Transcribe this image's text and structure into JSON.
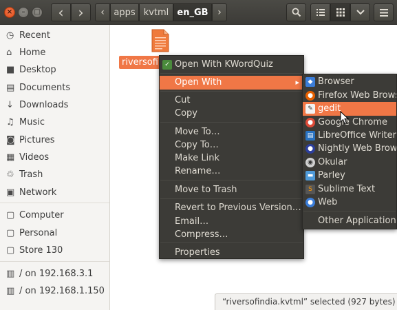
{
  "window": {
    "controls": {
      "close": "×",
      "minimize": "–",
      "maximize": "□"
    }
  },
  "toolbar": {
    "back_icon": "‹",
    "forward_icon": "›",
    "path_left_icon": "‹",
    "path_right_icon": "›",
    "breadcrumbs": [
      "apps",
      "kvtml",
      "en_GB"
    ],
    "search_icon": "search-icon",
    "list_view_icon": "list-icon",
    "grid_view_icon": "grid-icon",
    "view_options_icon": "chevron-down-icon",
    "menu_icon": "hamburger-icon"
  },
  "sidebar": {
    "items": [
      {
        "label": "Recent",
        "icon": "clock-icon",
        "glyph": "◷"
      },
      {
        "label": "Home",
        "icon": "home-icon",
        "glyph": "⌂"
      },
      {
        "label": "Desktop",
        "icon": "folder-icon",
        "glyph": "■"
      },
      {
        "label": "Documents",
        "icon": "document-icon",
        "glyph": "▤"
      },
      {
        "label": "Downloads",
        "icon": "download-icon",
        "glyph": "↓"
      },
      {
        "label": "Music",
        "icon": "music-icon",
        "glyph": "♫"
      },
      {
        "label": "Pictures",
        "icon": "camera-icon",
        "glyph": "◙"
      },
      {
        "label": "Videos",
        "icon": "film-icon",
        "glyph": "▦"
      },
      {
        "label": "Trash",
        "icon": "trash-icon",
        "glyph": "♲"
      },
      {
        "label": "Network",
        "icon": "network-icon",
        "glyph": "▣"
      },
      {
        "label": "Computer",
        "icon": "drive-icon",
        "glyph": "▢"
      },
      {
        "label": "Personal",
        "icon": "drive-icon",
        "glyph": "▢"
      },
      {
        "label": "Store 130",
        "icon": "drive-icon",
        "glyph": "▢"
      },
      {
        "label": "/ on 192.168.3.1",
        "icon": "network-share-icon",
        "glyph": "▥"
      },
      {
        "label": "/ on 192.168.1.150",
        "icon": "network-share-icon",
        "glyph": "▥"
      }
    ]
  },
  "file": {
    "label": "riversofir",
    "icon": "kvtml-file-icon"
  },
  "context_menu": {
    "items": [
      {
        "label": "Open With KWordQuiz",
        "has_icon": true
      },
      {
        "label": "Open With",
        "has_submenu": true,
        "highlighted": true
      },
      {
        "label": "Cut"
      },
      {
        "label": "Copy"
      },
      {
        "label": "Move To…"
      },
      {
        "label": "Copy To…"
      },
      {
        "label": "Make Link"
      },
      {
        "label": "Rename…"
      },
      {
        "label": "Move to Trash"
      },
      {
        "label": "Revert to Previous Version…"
      },
      {
        "label": "Email…"
      },
      {
        "label": "Compress…"
      },
      {
        "label": "Properties"
      }
    ]
  },
  "submenu": {
    "items": [
      {
        "label": "Browser",
        "icon": "browser-icon",
        "color": "#3b7dd8"
      },
      {
        "label": "Firefox Web Browser",
        "icon": "firefox-icon",
        "color": "#e66000"
      },
      {
        "label": "gedit",
        "icon": "gedit-icon",
        "color": "#e8e8e8",
        "highlighted": true
      },
      {
        "label": "Google Chrome",
        "icon": "chrome-icon",
        "color": "#dd4b39"
      },
      {
        "label": "LibreOffice Writer",
        "icon": "writer-icon",
        "color": "#2a73c2"
      },
      {
        "label": "Nightly Web Browser",
        "icon": "nightly-icon",
        "color": "#2c3e9c"
      },
      {
        "label": "Okular",
        "icon": "okular-icon",
        "color": "#a0a0a0"
      },
      {
        "label": "Parley",
        "icon": "parley-icon",
        "color": "#4f9ad8"
      },
      {
        "label": "Sublime Text",
        "icon": "sublime-icon",
        "color": "#555555"
      },
      {
        "label": "Web",
        "icon": "web-icon",
        "color": "#3b7dd8"
      },
      {
        "label": "Other Application…",
        "icon": ""
      }
    ]
  },
  "statusbar": {
    "text": "“riversofindia.kvtml” selected  (927 bytes)"
  },
  "colors": {
    "accent": "#f07746",
    "headerbar": "#3c3b37",
    "menu_bg": "#3c3b37"
  }
}
